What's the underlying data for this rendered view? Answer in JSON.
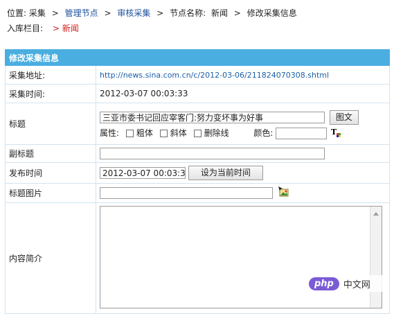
{
  "breadcrumb": {
    "position_label": "位置:",
    "item1": "采集",
    "item2": "管理节点",
    "item3": "审核采集",
    "item4": "节点名称:",
    "node_name": "新闻",
    "item5": "修改采集信息",
    "sep": ">"
  },
  "column": {
    "label": "入库栏目:",
    "value": "> 新闻"
  },
  "form": {
    "section_title": "修改采集信息",
    "collect_url_label": "采集地址:",
    "collect_url": "http://news.sina.com.cn/c/2012-03-06/211824070308.shtml",
    "collect_time_label": "采集时间:",
    "collect_time": "2012-03-07 00:03:33",
    "title_label": "标题",
    "title_value": "三亚市委书记回应宰客门:努力变坏事为好事",
    "title_image_btn": "图文",
    "attr_label": "属性:",
    "bold_label": "粗体",
    "italic_label": "斜体",
    "strike_label": "删除线",
    "color_label": "颜色:",
    "subtitle_label": "副标题",
    "subtitle_value": "",
    "publish_time_label": "发布时间",
    "publish_time_value": "2012-03-07 00:03:33",
    "set_now_btn": "设为当前时间",
    "title_pic_label": "标题图片",
    "title_pic_value": "",
    "summary_label": "内容简介",
    "summary_value": ""
  },
  "watermark": {
    "badge": "php",
    "text": "中文网"
  }
}
